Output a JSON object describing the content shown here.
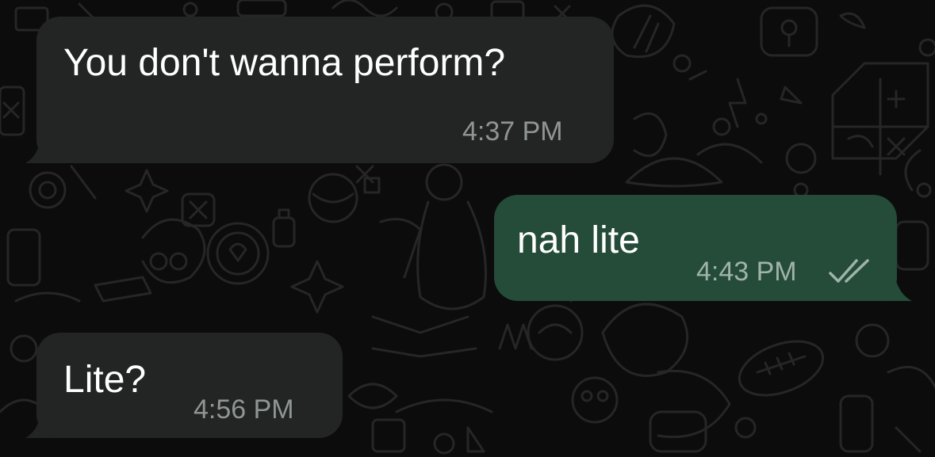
{
  "messages": [
    {
      "direction": "incoming",
      "text": "You don't wanna perform?",
      "time": "4:37 PM"
    },
    {
      "direction": "outgoing",
      "text": "nah lite",
      "time": "4:43 PM",
      "status_icon": "double-check-icon"
    },
    {
      "direction": "incoming",
      "text": "Lite?",
      "time": "4:56 PM"
    }
  ],
  "colors": {
    "background": "#0c0c0c",
    "incoming_bubble": "#232524",
    "outgoing_bubble": "#254b39",
    "time_text": "#8f9593",
    "read_check": "#9fb3a9"
  }
}
